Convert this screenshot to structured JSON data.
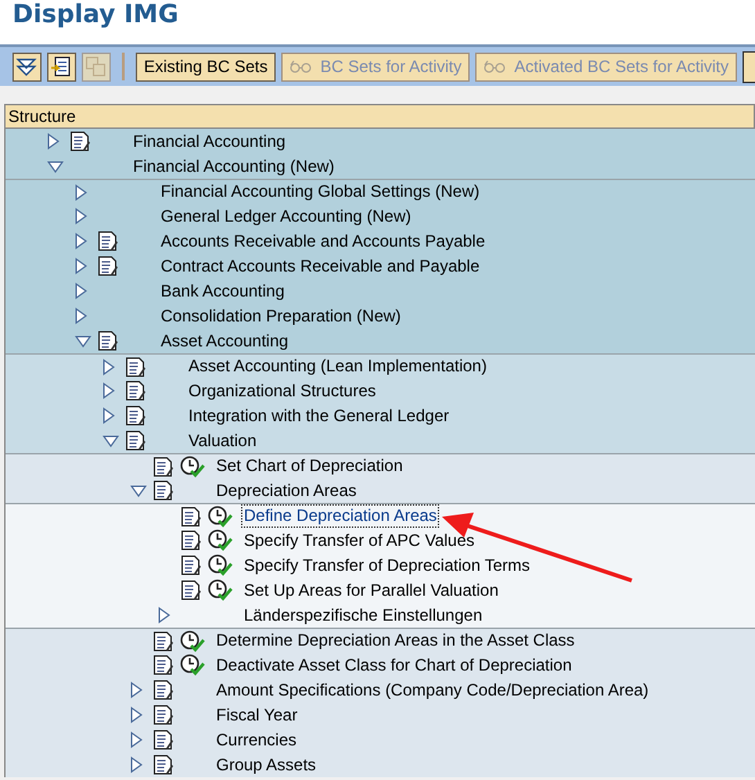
{
  "window": {
    "title": "Display IMG"
  },
  "toolbar": {
    "icons": [
      {
        "kind": "expand",
        "disabled": false
      },
      {
        "kind": "document",
        "disabled": false
      },
      {
        "kind": "copy",
        "disabled": true
      }
    ],
    "buttons": [
      {
        "label": "Existing BC Sets",
        "disabled": false
      },
      {
        "label": "BC Sets for Activity",
        "disabled": true,
        "icon": true
      },
      {
        "label": "Activated BC Sets for Activity",
        "disabled": true,
        "icon": true
      }
    ]
  },
  "tree": {
    "header": "Structure",
    "nodes": [
      {
        "text": "Financial Accounting",
        "expanded": false,
        "doc": true
      },
      {
        "text": "Financial Accounting (New)",
        "expanded": true,
        "children": [
          {
            "text": "Financial Accounting Global Settings (New)",
            "expanded": false
          },
          {
            "text": "General Ledger Accounting (New)",
            "expanded": false
          },
          {
            "text": "Accounts Receivable and Accounts Payable",
            "expanded": false,
            "doc": true
          },
          {
            "text": "Contract Accounts Receivable and Payable",
            "expanded": false,
            "doc": true
          },
          {
            "text": "Bank Accounting",
            "expanded": false
          },
          {
            "text": "Consolidation Preparation (New)",
            "expanded": false
          },
          {
            "text": "Asset Accounting",
            "expanded": true,
            "doc": true,
            "children": [
              {
                "text": "Asset Accounting (Lean Implementation)",
                "expanded": false,
                "doc": true
              },
              {
                "text": "Organizational Structures",
                "expanded": false,
                "doc": true
              },
              {
                "text": "Integration with the General Ledger",
                "expanded": false,
                "doc": true
              },
              {
                "text": "Valuation",
                "expanded": true,
                "doc": true,
                "children": [
                  {
                    "text": "Set Chart of Depreciation",
                    "doc": true,
                    "activity": true
                  },
                  {
                    "text": "Depreciation Areas",
                    "expanded": true,
                    "doc": true,
                    "children": [
                      {
                        "text": "Define Depreciation Areas",
                        "doc": true,
                        "activity": true,
                        "selected": true
                      },
                      {
                        "text": "Specify Transfer of APC Values",
                        "doc": true,
                        "activity": true,
                        "selected": false
                      },
                      {
                        "text": "Specify Transfer of Depreciation Terms",
                        "doc": true,
                        "activity": true,
                        "selected": false
                      },
                      {
                        "text": "Set Up Areas for Parallel Valuation",
                        "doc": true,
                        "activity": true,
                        "selected": false
                      },
                      {
                        "text": "Länderspezifische Einstellungen",
                        "expanded": false,
                        "selected": false
                      }
                    ]
                  },
                  {
                    "text": "Determine Depreciation Areas in the Asset Class",
                    "doc": true,
                    "activity": true
                  },
                  {
                    "text": "Deactivate Asset Class for Chart of Depreciation",
                    "doc": true,
                    "activity": true
                  },
                  {
                    "text": "Amount Specifications (Company Code/Depreciation Area)",
                    "expanded": false,
                    "doc": true
                  },
                  {
                    "text": "Fiscal Year",
                    "expanded": false,
                    "doc": true
                  },
                  {
                    "text": "Currencies",
                    "expanded": false,
                    "doc": true
                  },
                  {
                    "text": "Group Assets",
                    "expanded": false,
                    "doc": true
                  }
                ]
              }
            ]
          }
        ]
      }
    ]
  }
}
